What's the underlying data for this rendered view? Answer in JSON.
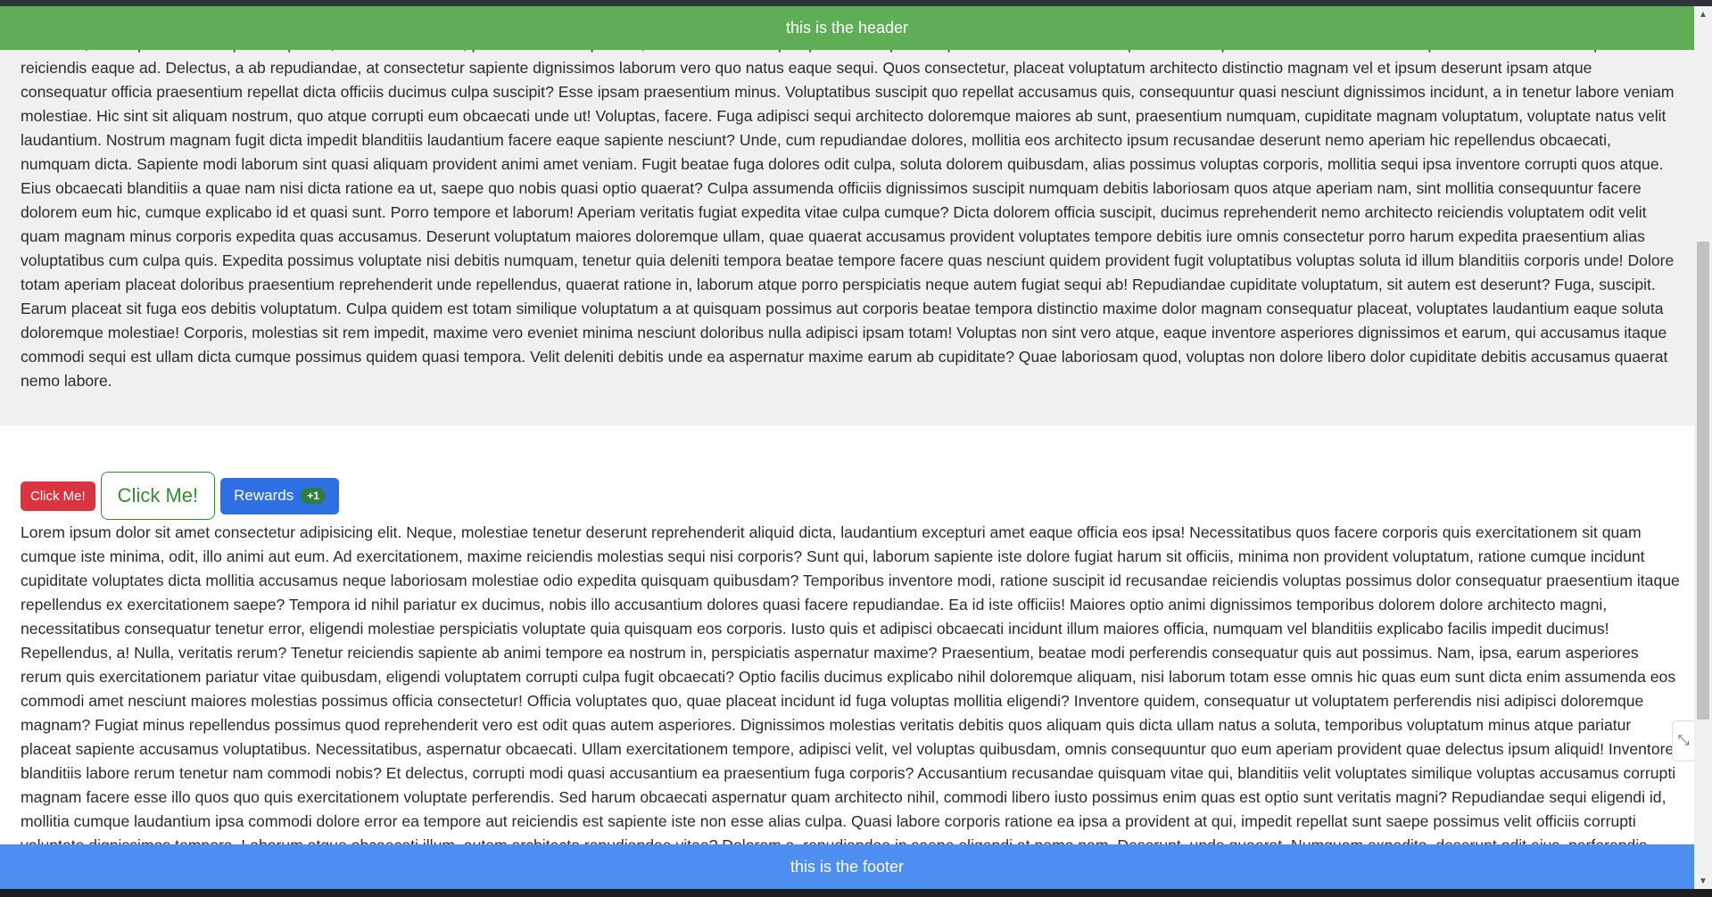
{
  "header": {
    "text": "this is the header"
  },
  "footer": {
    "text": "this is the footer"
  },
  "colors": {
    "header_bg": "#5fad56",
    "footer_bg": "#4d8ef0",
    "danger": "#d9343f",
    "outline_green": "#3a8a3a",
    "primary": "#2f6fe4",
    "badge": "#2e7d3e"
  },
  "buttons": {
    "click_me_small": "Click Me!",
    "click_me_large": "Click Me!",
    "rewards": "Rewards",
    "rewards_badge": "+1"
  },
  "content": {
    "top_paragraph": "Deserunt, unde quaerat. Numquam expedita, deserunt odit eius, perferendis corrupti cum, dicta modi rem ex perspiciatis voluptatum quae nesciunt veniam voluptatibus iste quibusdam sint laudantium adipisci dolorum nemo saepe reiciendis eaque ad. Delectus, a ab repudiandae, at consectetur sapiente dignissimos laborum vero quo natus eaque sequi. Quos consectetur, placeat voluptatum architecto distinctio magnam vel et ipsum deserunt ipsam atque consequatur officia praesentium repellat dicta officiis ducimus culpa suscipit? Esse ipsam praesentium minus. Voluptatibus suscipit quo repellat accusamus quis, consequuntur quasi nesciunt dignissimos incidunt, a in tenetur labore veniam molestiae. Hic sint sit aliquam nostrum, quo atque corrupti eum obcaecati unde ut! Voluptas, facere. Fuga adipisci sequi architecto doloremque maiores ab sunt, praesentium numquam, cupiditate magnam voluptatum, voluptate natus velit laudantium. Nostrum magnam fugit dicta impedit blanditiis laudantium facere eaque sapiente nesciunt? Unde, cum repudiandae dolores, mollitia eos architecto ipsum recusandae deserunt nemo aperiam hic repellendus obcaecati, numquam dicta. Sapiente modi laborum sint quasi aliquam provident animi amet veniam. Fugit beatae fuga dolores odit culpa, soluta dolorem quibusdam, alias possimus voluptas corporis, mollitia sequi ipsa inventore corrupti quos atque. Eius obcaecati blanditiis a quae nam nisi dicta ratione ea ut, saepe quo nobis quasi optio quaerat? Culpa assumenda officiis dignissimos suscipit numquam debitis laboriosam quos atque aperiam nam, sint mollitia consequuntur facere dolorem eum hic, cumque explicabo id et quasi sunt. Porro tempore et laborum! Aperiam veritatis fugiat expedita vitae culpa cumque? Dicta dolorem officia suscipit, ducimus reprehenderit nemo architecto reiciendis voluptatem odit velit quam magnam minus corporis expedita quas accusamus. Deserunt voluptatum maiores doloremque ullam, quae quaerat accusamus provident voluptates tempore debitis iure omnis consectetur porro harum expedita praesentium alias voluptatibus cum culpa quis. Expedita possimus voluptate nisi debitis numquam, tenetur quia deleniti tempora beatae tempore facere quas nesciunt quidem provident fugit voluptatibus voluptas soluta id illum blanditiis corporis unde! Dolore totam aperiam placeat doloribus praesentium reprehenderit unde repellendus, quaerat ratione in, laborum atque porro perspiciatis neque autem fugiat sequi ab! Repudiandae cupiditate voluptatum, sit autem est deserunt? Fuga, suscipit. Earum placeat sit fuga eos debitis voluptatum. Culpa quidem est totam similique voluptatum a at quisquam possimus aut corporis beatae tempora distinctio maxime dolor magnam consequatur placeat, voluptates laudantium eaque soluta doloremque molestiae! Corporis, molestias sit rem impedit, maxime vero eveniet minima nesciunt doloribus nulla adipisci ipsam totam! Voluptas non sint vero atque, eaque inventore asperiores dignissimos et earum, qui accusamus itaque commodi sequi est ullam dicta cumque possimus quidem quasi tempora. Velit deleniti debitis unde ea aspernatur maxime earum ab cupiditate? Quae laboriosam quod, voluptas non dolore libero dolor cupiditate debitis accusamus quaerat nemo labore.",
    "bottom_paragraph": "Lorem ipsum dolor sit amet consectetur adipisicing elit. Neque, molestiae tenetur deserunt reprehenderit aliquid dicta, laudantium excepturi amet eaque officia eos ipsa! Necessitatibus quos facere corporis quis exercitationem sit quam cumque iste minima, odit, illo animi aut eum. Ad exercitationem, maxime reiciendis molestias sequi nisi corporis? Sunt qui, laborum sapiente iste dolore fugiat harum sit officiis, minima non provident voluptatum, ratione cumque incidunt cupiditate voluptates dicta mollitia accusamus neque laboriosam molestiae odio expedita quisquam quibusdam? Temporibus inventore modi, ratione suscipit id recusandae reiciendis voluptas possimus dolor consequatur praesentium itaque repellendus ex exercitationem saepe? Tempora id nihil pariatur ex ducimus, nobis illo accusantium dolores quasi facere repudiandae. Ea id iste officiis! Maiores optio animi dignissimos temporibus dolorem dolore architecto magni, necessitatibus consequatur tenetur error, eligendi molestiae perspiciatis voluptate quia quisquam eos corporis. Iusto quis et adipisci obcaecati incidunt illum maiores officia, numquam vel blanditiis explicabo facilis impedit ducimus! Repellendus, a! Nulla, veritatis rerum? Tenetur reiciendis sapiente ab animi tempore ea nostrum in, perspiciatis aspernatur maxime? Praesentium, beatae modi perferendis consequatur quis aut possimus. Nam, ipsa, earum asperiores rerum quis exercitationem pariatur vitae quibusdam, eligendi voluptatem corrupti culpa fugit obcaecati? Optio facilis ducimus explicabo nihil doloremque aliquam, nisi laborum totam esse omnis hic quas eum sunt dicta enim assumenda eos commodi amet nesciunt maiores molestias possimus officia consectetur! Officia voluptates quo, quae placeat incidunt id fuga voluptas mollitia eligendi? Inventore quidem, consequatur ut voluptatem perferendis nisi adipisci doloremque magnam? Fugiat minus repellendus possimus quod reprehenderit vero est odit quas autem asperiores. Dignissimos molestias veritatis debitis quos aliquam quis dicta ullam natus a soluta, temporibus voluptatum minus atque pariatur placeat sapiente accusamus voluptatibus. Necessitatibus, aspernatur obcaecati. Ullam exercitationem tempore, adipisci velit, vel voluptas quibusdam, omnis consequuntur quo eum aperiam provident quae delectus ipsum aliquid! Inventore blanditiis labore rerum tenetur nam commodi nobis? Et delectus, corrupti modi quasi accusantium ea praesentium fuga corporis? Accusantium recusandae quisquam vitae qui, blanditiis velit voluptates similique voluptas accusamus corrupti magnam facere esse illo quos quo quis exercitationem voluptate perferendis. Sed harum obcaecati aspernatur quam architecto nihil, commodi libero iusto possimus enim quas est optio sunt veritatis magni? Repudiandae sequi eligendi id, mollitia cumque laudantium ipsa commodi dolore error ea tempore aut reiciendis est sapiente iste non esse alias culpa. Quasi labore corporis ratione ea ipsa a provident at qui, impedit repellat sunt saepe possimus velit officiis corrupti voluptate dignissimos tempora. Laborum atque obcaecati illum, autem architecto repudiandae vitae? Dolorem a, repudiandae in saepe eligendi at nemo nam. Deserunt, unde quaerat. Numquam expedita, deserunt odit eius, perferendis corrupti cum, dicta modi rem ex perspiciatis voluptatum quae nesciunt veniam voluptatibus iste quibusdam sint laudantium adipisci dolorum nemo saepe reiciendis eaque ad. Delectus, a ab repudiandae, at consectetur sapiente dignissimos laborum vero quo natus eaque sequi. Quos consectetur, placeat voluptatum architecto distinctio magnam vel et ipsum deserunt ipsam atque"
  },
  "icons": {
    "scroll_up": "scroll-up-arrow-icon",
    "scroll_down": "scroll-down-arrow-icon",
    "resize": "resize-handle-icon"
  }
}
